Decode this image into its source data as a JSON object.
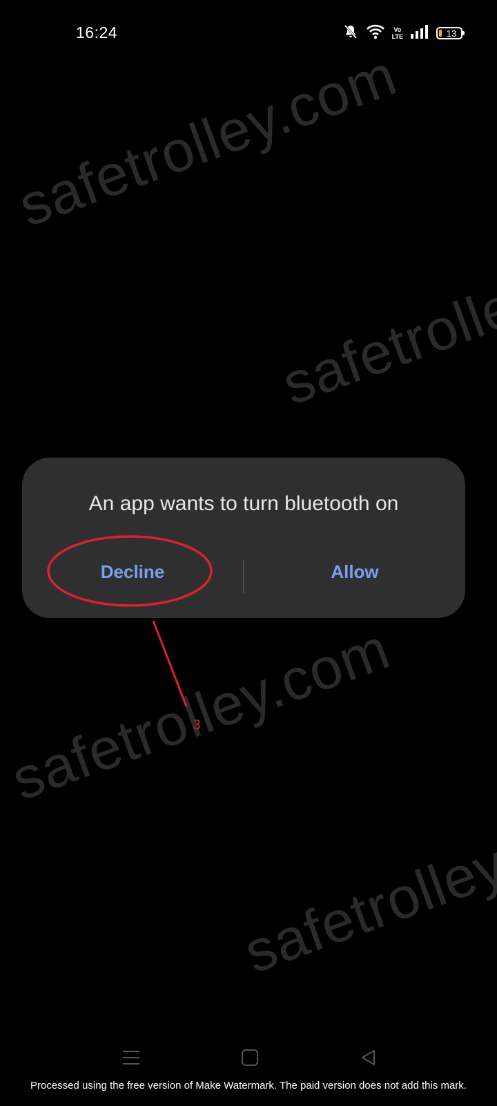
{
  "status_bar": {
    "time": "16:24",
    "volte_top": "Vo",
    "volte_bottom": "LTE",
    "battery_level": "13"
  },
  "watermarks": [
    "safetrolley.com",
    "safetrolley",
    "safetrolley.com",
    "safetrolley"
  ],
  "dialog": {
    "title": "An app wants to turn bluetooth on",
    "decline_label": "Decline",
    "allow_label": "Allow"
  },
  "annotation": {
    "step_number": "3",
    "color": "#d9232d"
  },
  "footer": {
    "notice": "Processed using the free version of Make Watermark. The paid version does not add this mark."
  },
  "colors": {
    "background": "#000000",
    "dialog_bg": "#2f2f2f",
    "button_text": "#7a9ff0",
    "battery_low": "#f3b11c"
  }
}
